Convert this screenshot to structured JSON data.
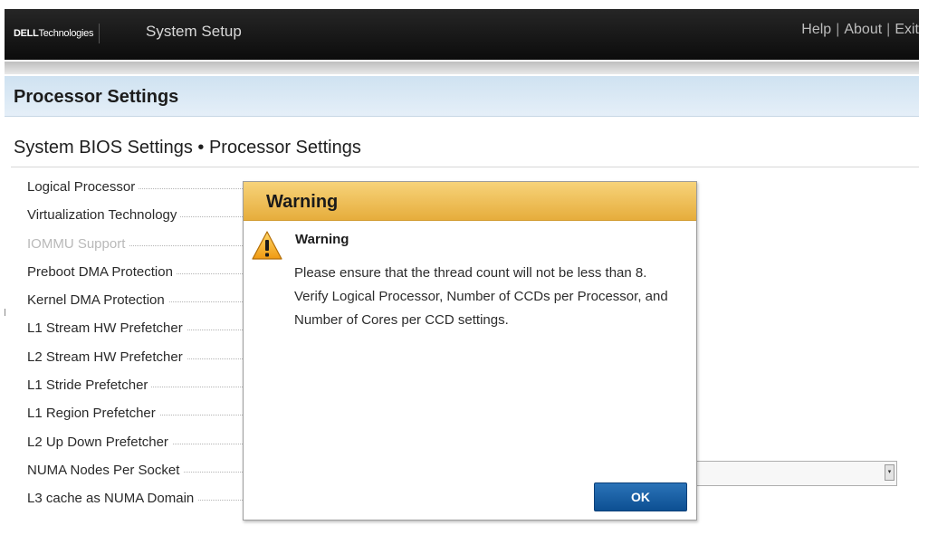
{
  "header": {
    "brand": {
      "bold": "DELL",
      "rest": "Technologies"
    },
    "app_title": "System Setup",
    "links": {
      "help": "Help",
      "about": "About",
      "exit": "Exit",
      "separator": "|"
    }
  },
  "page": {
    "section_title": "Processor Settings",
    "breadcrumb": "System BIOS Settings • Processor Settings"
  },
  "settings": [
    {
      "label": "Logical Processor",
      "disabled": false
    },
    {
      "label": "Virtualization Technology",
      "disabled": false
    },
    {
      "label": "IOMMU Support",
      "disabled": true
    },
    {
      "label": "Preboot DMA Protection",
      "disabled": false
    },
    {
      "label": "Kernel DMA Protection",
      "disabled": false
    },
    {
      "label": "L1 Stream HW Prefetcher",
      "disabled": false
    },
    {
      "label": "L2 Stream HW Prefetcher",
      "disabled": false
    },
    {
      "label": "L1 Stride Prefetcher",
      "disabled": false
    },
    {
      "label": "L1 Region Prefetcher",
      "disabled": false
    },
    {
      "label": "L2 Up Down Prefetcher",
      "disabled": false
    },
    {
      "label": "NUMA Nodes Per Socket",
      "disabled": false
    },
    {
      "label": "L3 cache as NUMA Domain",
      "disabled": false
    }
  ],
  "dialog": {
    "title": "Warning",
    "heading": "Warning",
    "message": "Please ensure that the thread count will not be less than 8. Verify Logical Processor, Number of CCDs per Processor, and Number of Cores per CCD settings.",
    "ok_label": "OK",
    "icon": "warning-icon"
  },
  "colors": {
    "header_bg": "#111111",
    "section_bg": "#d6e7f4",
    "dialog_title_bg": "#edb64b",
    "ok_button_bg": "#1a5fa4",
    "disabled_text": "#b9b9b9"
  }
}
